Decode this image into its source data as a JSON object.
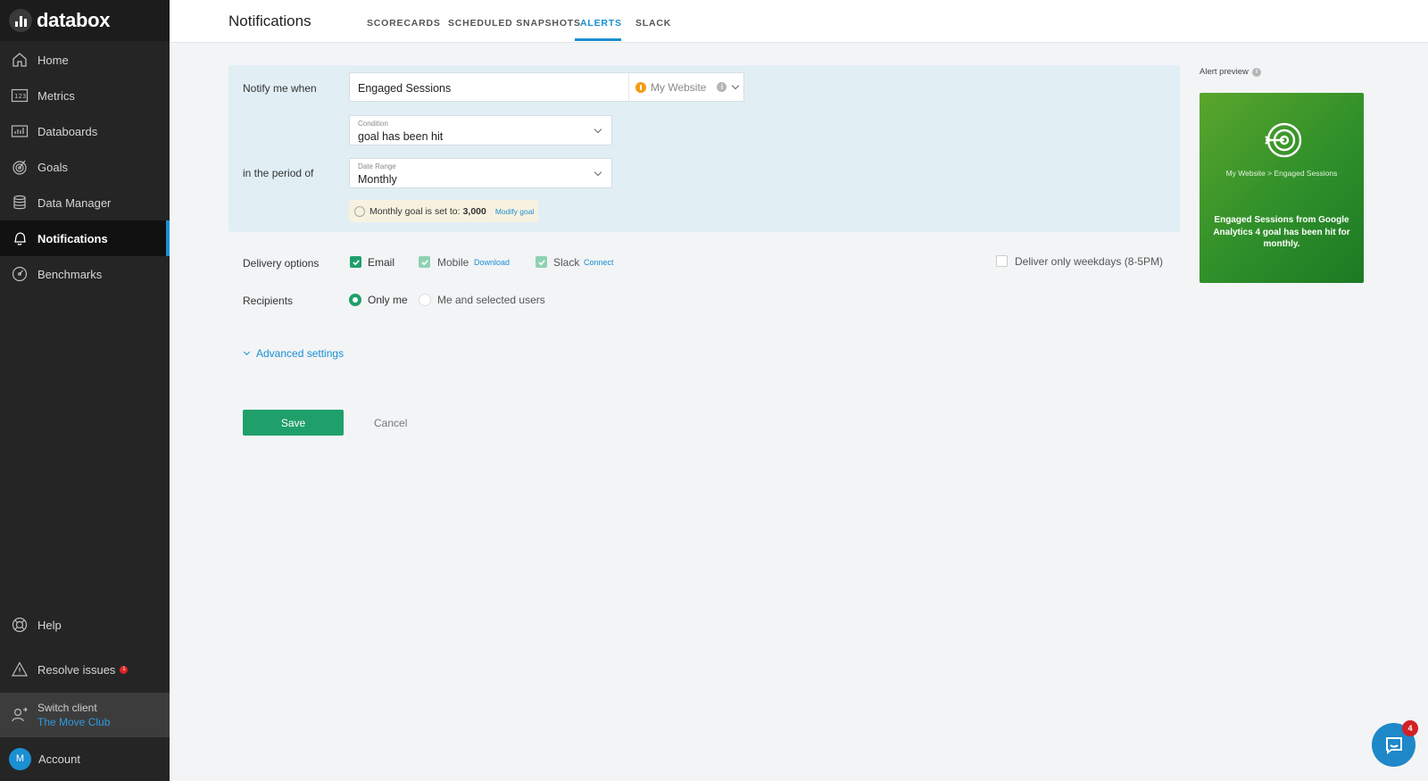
{
  "brand": {
    "logo_text": "databox"
  },
  "sidebar": {
    "items": [
      {
        "label": "Home",
        "icon": "home-icon"
      },
      {
        "label": "Metrics",
        "icon": "metrics-123-icon"
      },
      {
        "label": "Databoards",
        "icon": "databoard-icon"
      },
      {
        "label": "Goals",
        "icon": "goal-target-icon"
      },
      {
        "label": "Data Manager",
        "icon": "database-icon"
      },
      {
        "label": "Notifications",
        "icon": "bell-icon",
        "active": true
      },
      {
        "label": "Benchmarks",
        "icon": "benchmark-gauge-icon"
      }
    ],
    "help": "Help",
    "resolve_issues": "Resolve issues",
    "resolve_issues_count": "1",
    "switch_client_label": "Switch client",
    "client_name": "The Move Club",
    "account": "Account",
    "account_initial": "M"
  },
  "header": {
    "title": "Notifications",
    "tabs": [
      "SCORECARDS",
      "SCHEDULED SNAPSHOTS",
      "ALERTS",
      "SLACK"
    ],
    "active_tab": "ALERTS"
  },
  "form": {
    "notify_label": "Notify me when",
    "metric_value": "Engaged Sessions",
    "source_value": "My Website",
    "condition_caption": "Condition",
    "condition_value": "goal has been hit",
    "period_label": "in the period of",
    "date_range_caption": "Date Range",
    "date_range_value": "Monthly",
    "goal_text": "Monthly goal is set to:",
    "goal_value": "3,000",
    "modify_goal": "Modify goal",
    "delivery_label": "Delivery options",
    "email": "Email",
    "mobile": "Mobile",
    "download": "Download",
    "slack": "Slack",
    "connect": "Connect",
    "weekdays": "Deliver only weekdays (8-5PM)",
    "recipients_label": "Recipients",
    "only_me": "Only me",
    "me_and_selected": "Me and selected users",
    "advanced": "Advanced settings",
    "save": "Save",
    "cancel": "Cancel"
  },
  "preview": {
    "label": "Alert preview",
    "path": "My Website > Engaged Sessions",
    "message": "Engaged Sessions from Google Analytics 4 goal has been hit for monthly."
  },
  "chat": {
    "badge_count": "4"
  },
  "colors": {
    "accent": "#1b8fd2",
    "success": "#1fa06a",
    "sidebar_bg": "#252525",
    "panel_bg": "#e1eff5"
  }
}
